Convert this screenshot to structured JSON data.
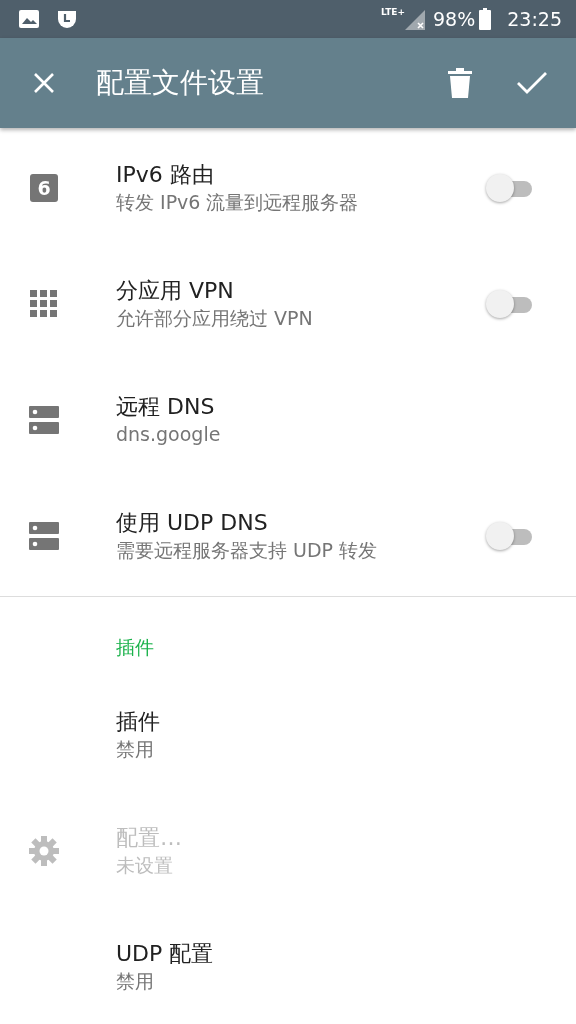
{
  "status_bar": {
    "network": "LTE+",
    "battery": "98%",
    "time": "23:25"
  },
  "toolbar": {
    "title": "配置文件设置"
  },
  "items": [
    {
      "kind": "switch",
      "icon_label": "6",
      "title": "IPv6 路由",
      "summary": "转发 IPv6 流量到远程服务器",
      "checked": false,
      "disabled": false
    },
    {
      "kind": "switch",
      "title": "分应用 VPN",
      "summary": "允许部分应用绕过 VPN",
      "checked": false,
      "disabled": false
    },
    {
      "kind": "plain",
      "title": "远程 DNS",
      "summary": "dns.google",
      "disabled": false
    },
    {
      "kind": "switch",
      "title": "使用 UDP DNS",
      "summary": "需要远程服务器支持 UDP 转发",
      "checked": false,
      "disabled": false
    },
    {
      "kind": "divider"
    },
    {
      "kind": "header",
      "title": "插件"
    },
    {
      "kind": "plain",
      "title": "插件",
      "summary": "禁用",
      "disabled": false
    },
    {
      "kind": "plain",
      "title": "配置…",
      "summary": "未设置",
      "disabled": true
    },
    {
      "kind": "plain",
      "title": "UDP 配置",
      "summary": "禁用",
      "disabled": false
    }
  ]
}
